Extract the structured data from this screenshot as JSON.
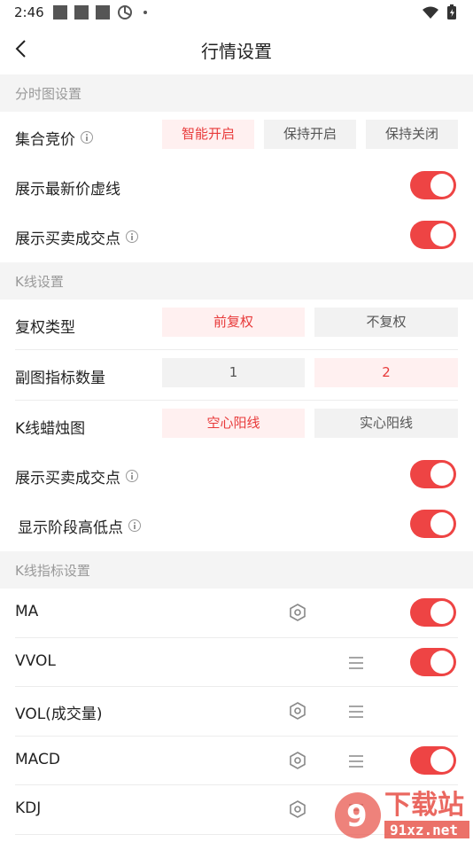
{
  "status": {
    "time": "2:46"
  },
  "nav": {
    "title": "行情设置"
  },
  "sections": {
    "intraday": "分时图设置",
    "kline": "K线设置",
    "indicators": "K线指标设置"
  },
  "intraday": {
    "auction": {
      "label": "集合竞价",
      "options": [
        "智能开启",
        "保持开启",
        "保持关闭"
      ],
      "selected": "智能开启"
    },
    "latest_price_line": {
      "label": "展示最新价虚线",
      "enabled": true
    },
    "trade_points": {
      "label": "展示买卖成交点",
      "enabled": true
    }
  },
  "kline": {
    "adjust_type": {
      "label": "复权类型",
      "options": [
        "前复权",
        "不复权"
      ],
      "selected": "前复权"
    },
    "sub_chart_count": {
      "label": "副图指标数量",
      "options": [
        "1",
        "2"
      ],
      "selected": "2"
    },
    "candle_style": {
      "label": "K线蜡烛图",
      "options": [
        "空心阳线",
        "实心阳线"
      ],
      "selected": "空心阳线"
    },
    "trade_points": {
      "label": "展示买卖成交点",
      "enabled": true
    },
    "stage_high_low": {
      "label": "显示阶段高低点",
      "enabled": true
    }
  },
  "indicators": [
    {
      "name": "MA",
      "has_settings": true,
      "has_drag": false,
      "enabled": true
    },
    {
      "name": "VVOL",
      "has_settings": false,
      "has_drag": true,
      "enabled": true
    },
    {
      "name": "VOL(成交量)",
      "has_settings": true,
      "has_drag": true,
      "enabled": false
    },
    {
      "name": "MACD",
      "has_settings": true,
      "has_drag": true,
      "enabled": true
    },
    {
      "name": "KDJ",
      "has_settings": true,
      "has_drag": true,
      "enabled": false
    }
  ],
  "watermark": {
    "text": "下载站",
    "url_text": "91xz.net"
  },
  "colors": {
    "accent": "#ee4444",
    "active_bg": "#fff0f0",
    "inactive_bg": "#f2f2f2",
    "section_bg": "#f4f4f4"
  }
}
